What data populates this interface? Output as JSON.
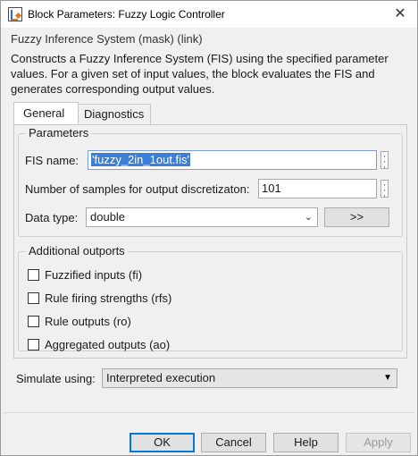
{
  "window": {
    "title": "Block Parameters: Fuzzy Logic Controller",
    "close_glyph": "✕",
    "app_icon": "simulink-block-icon"
  },
  "mask": {
    "title": "Fuzzy Inference System (mask) (link)",
    "description": "Constructs a Fuzzy Inference System (FIS) using the specified parameter values. For a given set of input values, the block evaluates the FIS and generates corresponding output values."
  },
  "tabs": [
    {
      "label": "General",
      "active": true
    },
    {
      "label": "Diagnostics",
      "active": false
    }
  ],
  "parameters": {
    "group_label": "Parameters",
    "fis_name_label": "FIS name:",
    "fis_name_value": "'fuzzy_2in_1out.fis'",
    "samples_label": "Number of samples for output discretizaton:",
    "samples_value": "101",
    "data_type_label": "Data type:",
    "data_type_value": "double",
    "assistant_button_label": ">>"
  },
  "outports": {
    "group_label": "Additional outports",
    "items": [
      {
        "label": "Fuzzified inputs (fi)",
        "checked": false
      },
      {
        "label": "Rule firing strengths (rfs)",
        "checked": false
      },
      {
        "label": "Rule outputs (ro)",
        "checked": false
      },
      {
        "label": "Aggregated outputs (ao)",
        "checked": false
      }
    ]
  },
  "simulate": {
    "label": "Simulate using:",
    "value": "Interpreted execution"
  },
  "footer": {
    "ok_label": "OK",
    "cancel_label": "Cancel",
    "help_label": "Help",
    "apply_label": "Apply"
  },
  "colors": {
    "accent": "#0078d7",
    "selection": "#3c7fd8",
    "window_bg": "#f0f0f0"
  }
}
